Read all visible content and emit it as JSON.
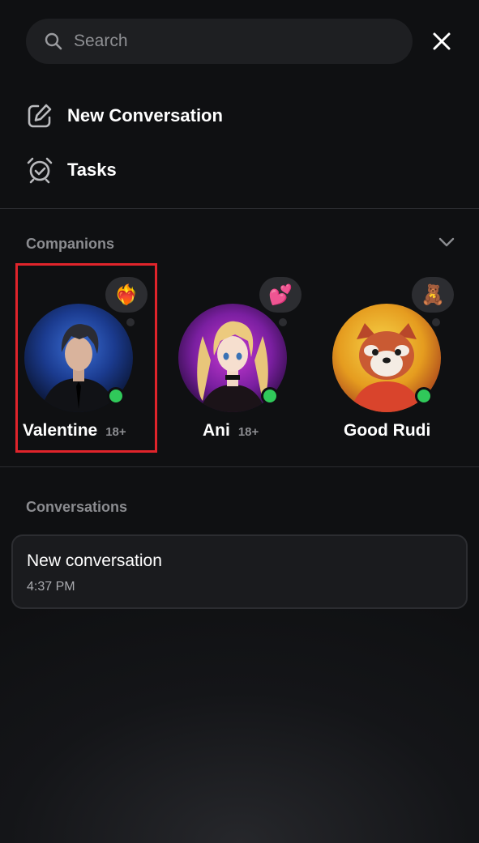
{
  "search": {
    "placeholder": "Search"
  },
  "menu": [
    {
      "label": "New Conversation",
      "icon": "compose-icon"
    },
    {
      "label": "Tasks",
      "icon": "alarm-clock-icon"
    }
  ],
  "companions": {
    "title": "Companions",
    "items": [
      {
        "name": "Valentine",
        "age": "18+",
        "badge": "❤️‍🔥",
        "online": true,
        "selected": true
      },
      {
        "name": "Ani",
        "age": "18+",
        "badge": "💕",
        "online": true,
        "selected": false
      },
      {
        "name": "Good Rudi",
        "badge": "🧸",
        "online": true,
        "selected": false
      }
    ]
  },
  "conversations": {
    "title": "Conversations",
    "items": [
      {
        "title": "New conversation",
        "time": "4:37 PM"
      }
    ]
  },
  "colors": {
    "online": "#30c95a",
    "highlight": "#e0242b",
    "muted": "#8b8c90"
  }
}
